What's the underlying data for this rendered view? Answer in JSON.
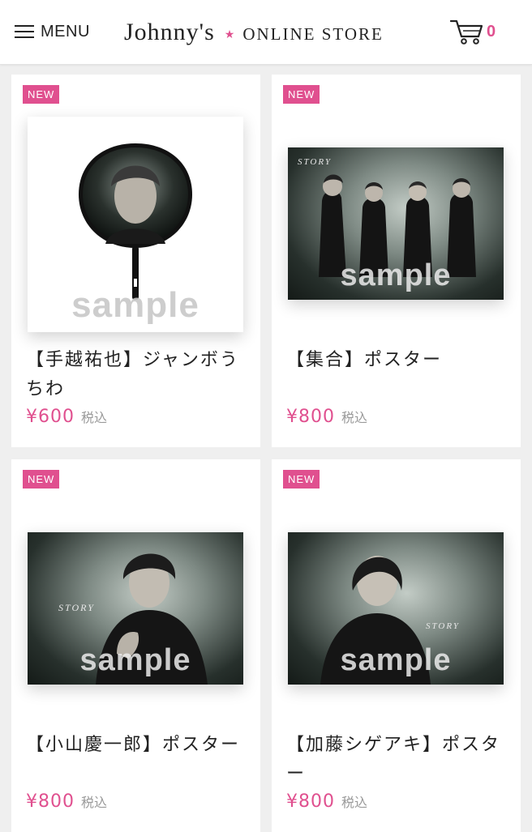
{
  "header": {
    "menu_label": "MENU",
    "logo_main": "Johnny's",
    "logo_sub": "ONLINE STORE",
    "cart_count": "0"
  },
  "colors": {
    "accent": "#e0508f"
  },
  "products": [
    {
      "badge": "NEW",
      "image_type": "uchiwa-fan",
      "watermark": "sample",
      "title": "【手越祐也】ジャンボうちわ",
      "price": "¥600",
      "tax_label": "税込"
    },
    {
      "badge": "NEW",
      "image_type": "group-poster",
      "watermark": "sample",
      "poster_text": "STORY",
      "title": "【集合】ポスター",
      "price": "¥800",
      "tax_label": "税込"
    },
    {
      "badge": "NEW",
      "image_type": "solo-poster",
      "watermark": "sample",
      "poster_text": "STORY",
      "title": "【小山慶一郎】ポスター",
      "price": "¥800",
      "tax_label": "税込"
    },
    {
      "badge": "NEW",
      "image_type": "solo-poster",
      "watermark": "sample",
      "poster_text": "STORY",
      "title": "【加藤シゲアキ】ポスター",
      "price": "¥800",
      "tax_label": "税込"
    }
  ]
}
